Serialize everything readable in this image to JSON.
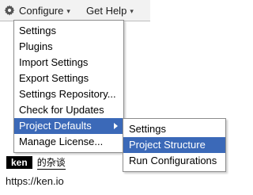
{
  "menubar": {
    "icon": "gear-icon",
    "configure_label": "Configure",
    "help_label": "Get Help",
    "caret": "▾"
  },
  "configure_menu": {
    "items": [
      {
        "label": "Settings"
      },
      {
        "label": "Plugins"
      },
      {
        "label": "Import Settings"
      },
      {
        "label": "Export Settings"
      },
      {
        "label": "Settings Repository..."
      },
      {
        "label": "Check for Updates"
      },
      {
        "label": "Project Defaults",
        "has_submenu": true,
        "highlighted": true
      },
      {
        "label": "Manage License..."
      }
    ]
  },
  "project_defaults_submenu": {
    "items": [
      {
        "label": "Settings"
      },
      {
        "label": "Project Structure",
        "highlighted": true
      },
      {
        "label": "Run Configurations"
      }
    ]
  },
  "watermark": {
    "badge": "ken",
    "title": "的杂谈",
    "url": "https://ken.io"
  },
  "colors": {
    "highlight": "#3b69b8",
    "menubar_bg": "#f2f2f2",
    "gear": "#555555"
  }
}
